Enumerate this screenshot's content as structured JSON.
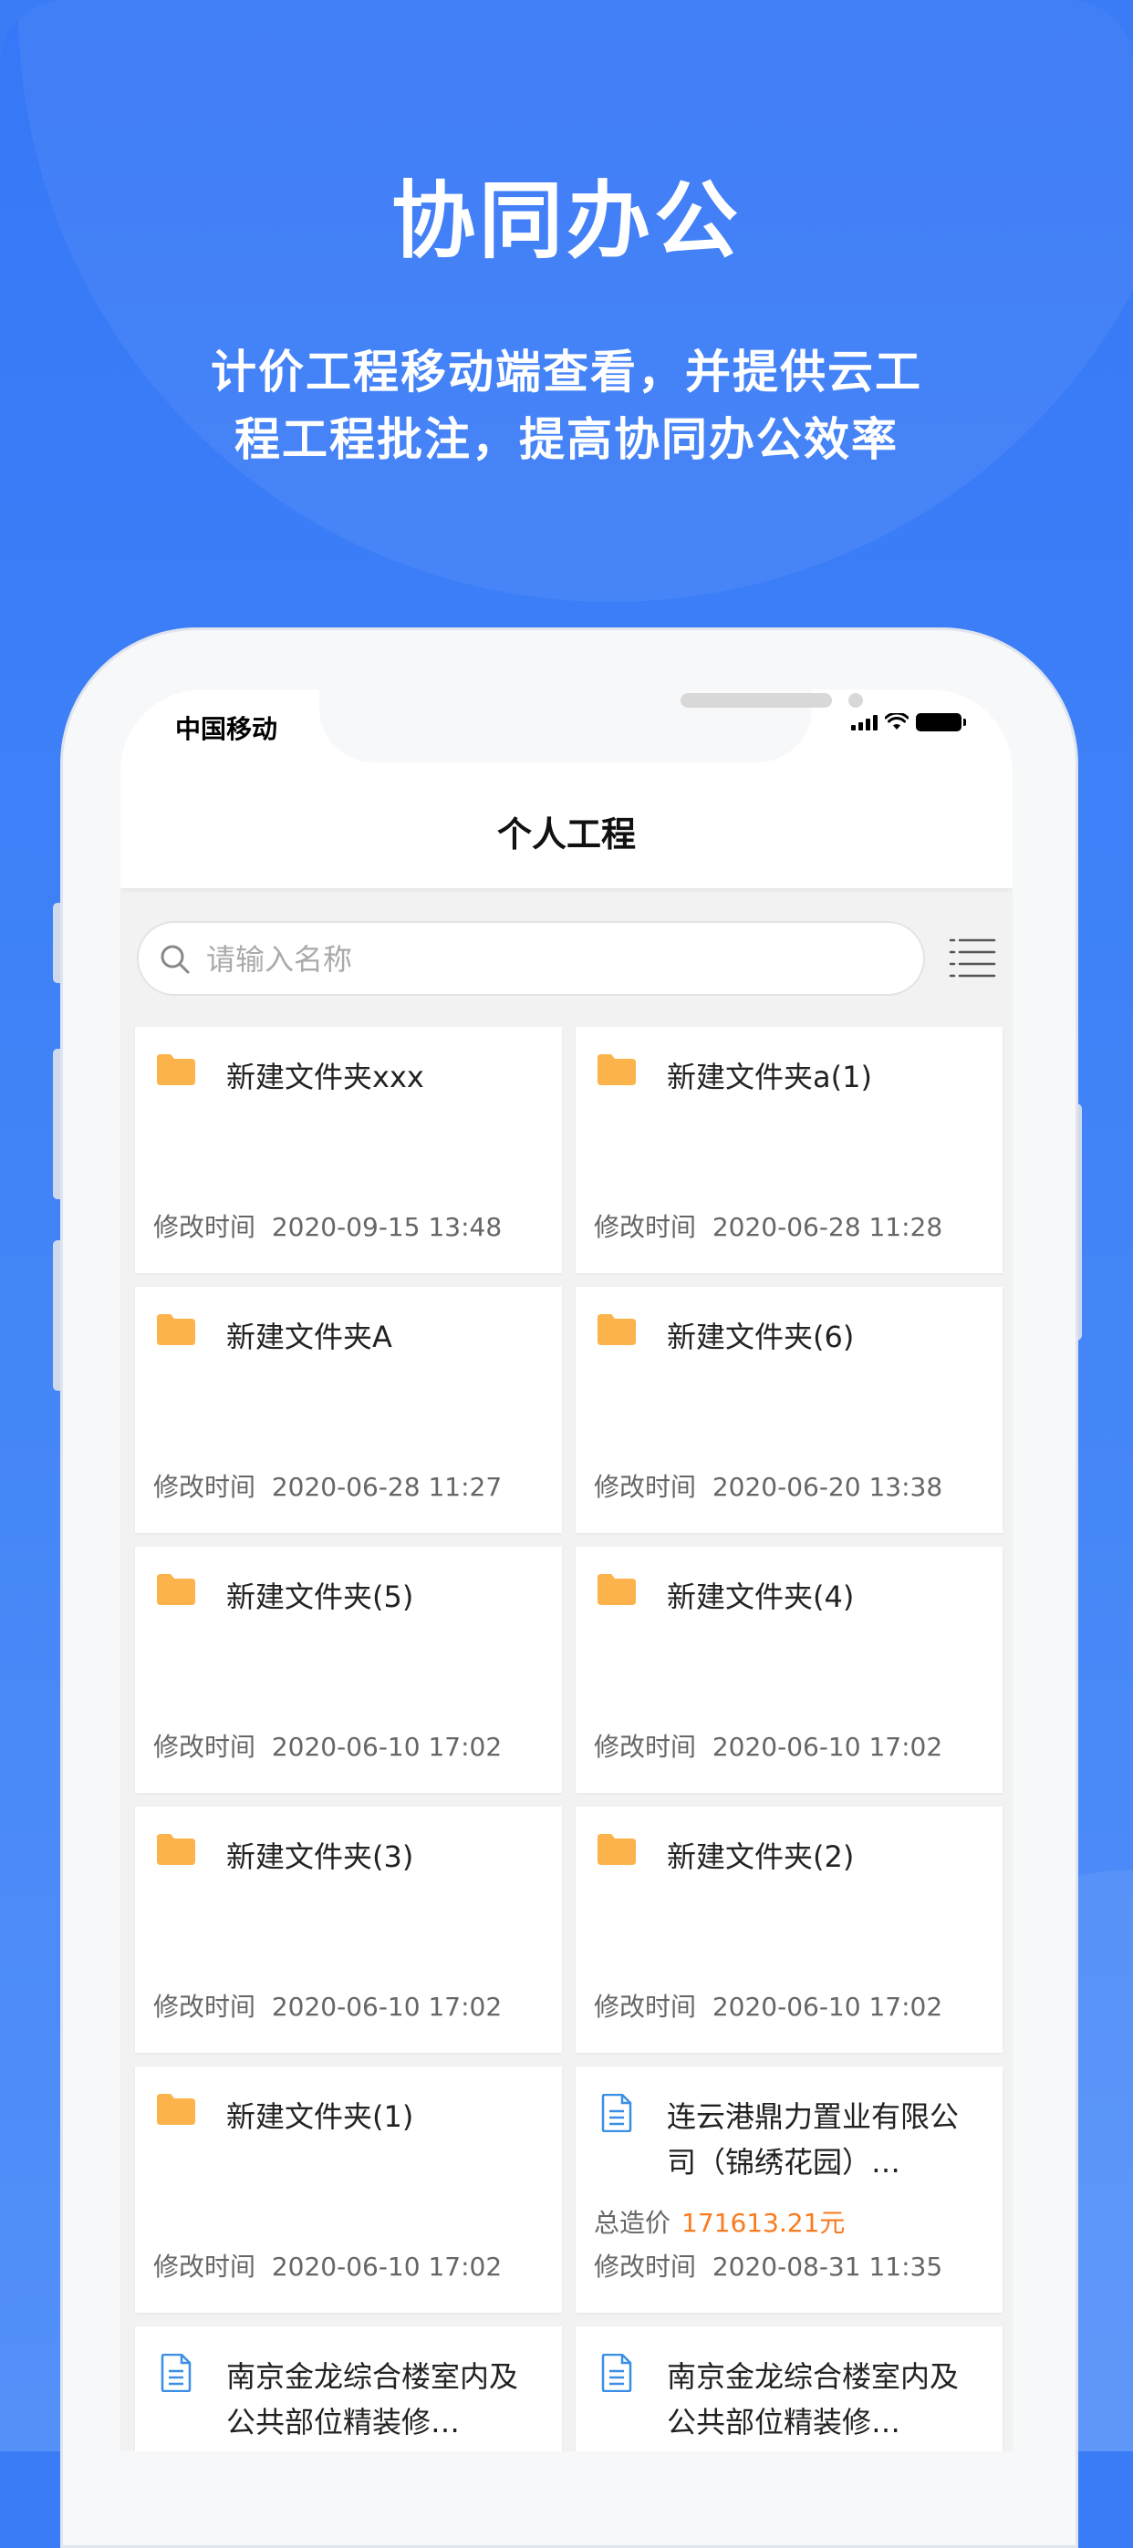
{
  "promo": {
    "title": "协同办公",
    "subtitle_line1": "计价工程移动端查看，并提供云工",
    "subtitle_line2": "程工程批注，提高协同办公效率"
  },
  "status_bar": {
    "carrier": "中国移动"
  },
  "navbar": {
    "title": "个人工程"
  },
  "search": {
    "placeholder": "请输入名称"
  },
  "colors": {
    "accent": "#3677f7",
    "folder": "#fdb34c",
    "doc": "#3a8ee6",
    "price": "#fa7a1d"
  },
  "items": [
    {
      "type": "folder",
      "name": "新建文件夹xxx",
      "time_label": "修改时间",
      "time": "2020-09-15 13:48"
    },
    {
      "type": "folder",
      "name": "新建文件夹a(1)",
      "time_label": "修改时间",
      "time": "2020-06-28 11:28"
    },
    {
      "type": "folder",
      "name": "新建文件夹A",
      "time_label": "修改时间",
      "time": "2020-06-28 11:27"
    },
    {
      "type": "folder",
      "name": "新建文件夹(6)",
      "time_label": "修改时间",
      "time": "2020-06-20 13:38"
    },
    {
      "type": "folder",
      "name": "新建文件夹(5)",
      "time_label": "修改时间",
      "time": "2020-06-10 17:02"
    },
    {
      "type": "folder",
      "name": "新建文件夹(4)",
      "time_label": "修改时间",
      "time": "2020-06-10 17:02"
    },
    {
      "type": "folder",
      "name": "新建文件夹(3)",
      "time_label": "修改时间",
      "time": "2020-06-10 17:02"
    },
    {
      "type": "folder",
      "name": "新建文件夹(2)",
      "time_label": "修改时间",
      "time": "2020-06-10 17:02"
    },
    {
      "type": "folder",
      "name": "新建文件夹(1)",
      "time_label": "修改时间",
      "time": "2020-06-10 17:02"
    },
    {
      "type": "project",
      "name": "连云港鼎力置业有限公司（锦绣花园）…",
      "price_label": "总造价",
      "price": "171613.21元",
      "time_label": "修改时间",
      "time": "2020-08-31 11:35"
    },
    {
      "type": "project",
      "name": "南京金龙综合楼室内及公共部位精装修…"
    },
    {
      "type": "project",
      "name": "南京金龙综合楼室内及公共部位精装修…"
    }
  ]
}
